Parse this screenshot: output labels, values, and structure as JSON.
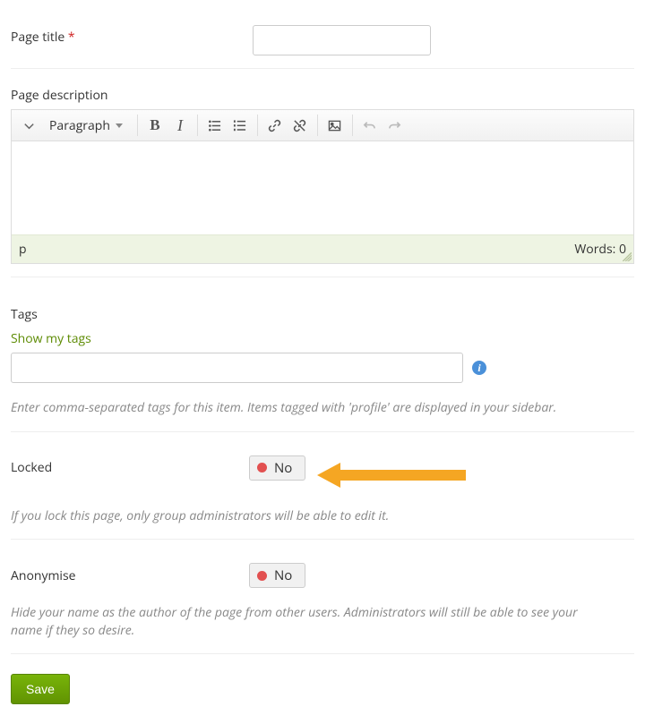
{
  "fields": {
    "page_title": {
      "label": "Page title",
      "required_mark": "*"
    },
    "page_description": {
      "label": "Page description"
    },
    "tags": {
      "label": "Tags",
      "show_link": "Show my tags",
      "help": "Enter comma-separated tags for this item. Items tagged with 'profile' are displayed in your sidebar."
    },
    "locked": {
      "label": "Locked",
      "value": "No",
      "help": "If you lock this page, only group administrators will be able to edit it."
    },
    "anonymise": {
      "label": "Anonymise",
      "value": "No",
      "help": "Hide your name as the author of the page from other users. Administrators will still be able to see your name if they so desire."
    }
  },
  "editor": {
    "format_label": "Paragraph",
    "status_path": "p",
    "words_label": "Words: 0"
  },
  "icons": {
    "info": "i"
  },
  "buttons": {
    "save": "Save"
  }
}
